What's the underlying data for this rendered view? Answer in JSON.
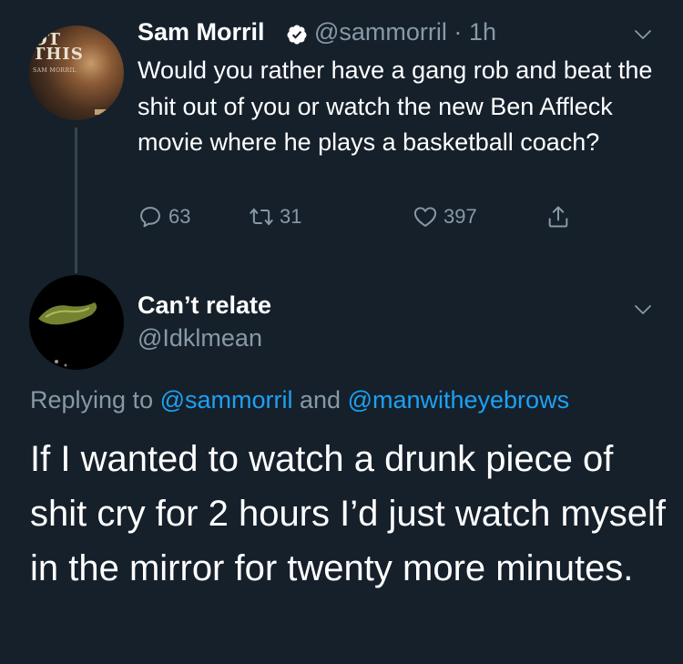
{
  "tweet": {
    "author_name": "Sam Morril",
    "handle": "@sammorril",
    "separator": "·",
    "time": "1h",
    "text": "Would you rather have a gang rob and beat the shit out of you or watch the new Ben Affleck movie where he plays a basketball coach?",
    "avatar_text_top": "OT\nTHIS",
    "avatar_text_small": "SAM MORRIL",
    "reply_count": "63",
    "retweet_count": "31",
    "like_count": "397",
    "icons": [
      "verified-badge-icon",
      "chevron-down-icon",
      "reply-icon",
      "retweet-icon",
      "heart-icon",
      "share-icon"
    ]
  },
  "reply": {
    "author_name": "Can’t relate",
    "handle": "@Idklmean",
    "replying_prefix": "Replying to ",
    "replying_user1": "@sammorril",
    "replying_and": " and ",
    "replying_user2": "@manwitheyebrows",
    "text": "If I wanted to watch a drunk piece of shit cry for 2 hours I’d just watch myself in the mirror for twenty more minutes."
  },
  "colors": {
    "background": "#15202b",
    "primary_text": "#ffffff",
    "secondary_text": "#8899a6",
    "link": "#1da1f2",
    "thread_line": "#38444d"
  }
}
